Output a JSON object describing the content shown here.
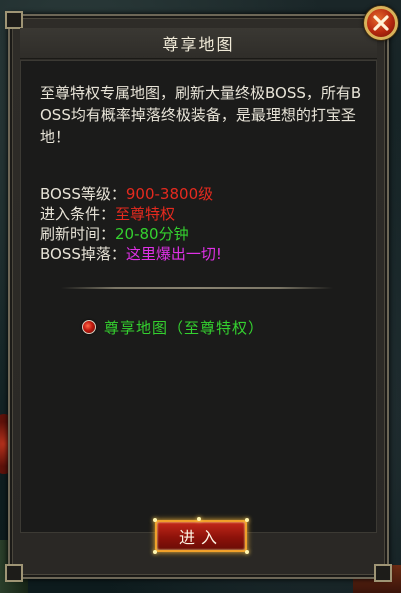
{
  "dialog": {
    "title": "尊享地图",
    "description": "至尊特权专属地图，刷新大量终极BOSS，所有BOSS均有概率掉落终极装备，是最理想的打宝圣地！",
    "info": [
      {
        "label": "BOSS等级：",
        "value": "900-3800级",
        "color": "red"
      },
      {
        "label": "进入条件：",
        "value": "至尊特权",
        "color": "red"
      },
      {
        "label": "刷新时间：",
        "value": "20-80分钟",
        "color": "green"
      },
      {
        "label": "BOSS掉落：",
        "value": "这里爆出一切!",
        "color": "magenta"
      }
    ],
    "option_label": "尊享地图（至尊特权）",
    "enter_label": "进入",
    "close_icon": "close-icon"
  },
  "colors": {
    "red": "#e52a1f",
    "green": "#34d12f",
    "magenta": "#df31e6",
    "text": "#e8e4d8"
  }
}
